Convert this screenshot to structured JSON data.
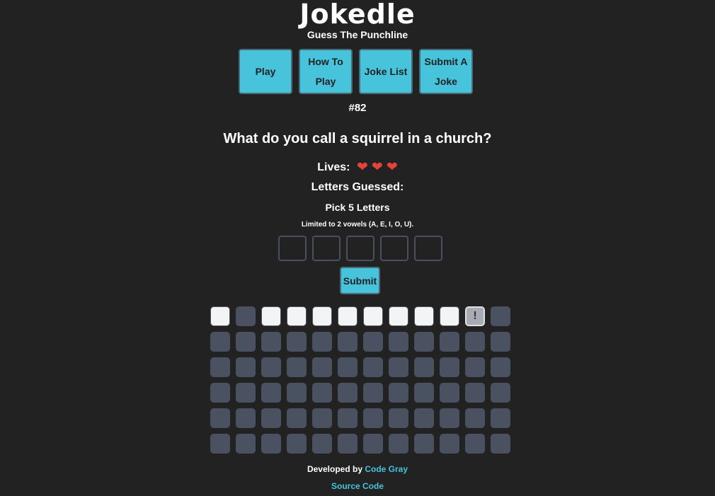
{
  "header": {
    "title": "Jokedle",
    "subtitle": "Guess The Punchline"
  },
  "nav": {
    "play": "Play",
    "how_to_play": "How To Play",
    "joke_list": "Joke List",
    "submit_joke": "Submit A Joke"
  },
  "game": {
    "puzzle_number": "#82",
    "question": "What do you call a squirrel in a church?",
    "lives_label": "Lives:",
    "lives": 3,
    "heart_glyph": "❤",
    "letters_guessed_label": "Letters Guessed:",
    "pick_label": "Pick 5 Letters",
    "limit_note": "Limited to 2 vowels (A, E, I, O, U).",
    "inputs": [
      "",
      "",
      "",
      "",
      ""
    ],
    "submit_label": "Submit",
    "punchline_row": [
      "",
      " ",
      "",
      "",
      "",
      "",
      "",
      "",
      "",
      "",
      "!",
      " "
    ],
    "grid_rows": 6,
    "grid_cols": 12
  },
  "footer": {
    "developed_by": "Developed by",
    "developer": "Code Gray",
    "source_code": "Source Code"
  },
  "colors": {
    "background": "#222222",
    "accent": "#47c3dc",
    "tile": "#4a5160",
    "tile_revealed": "#f3f4f6",
    "heart": "#e8413a"
  }
}
